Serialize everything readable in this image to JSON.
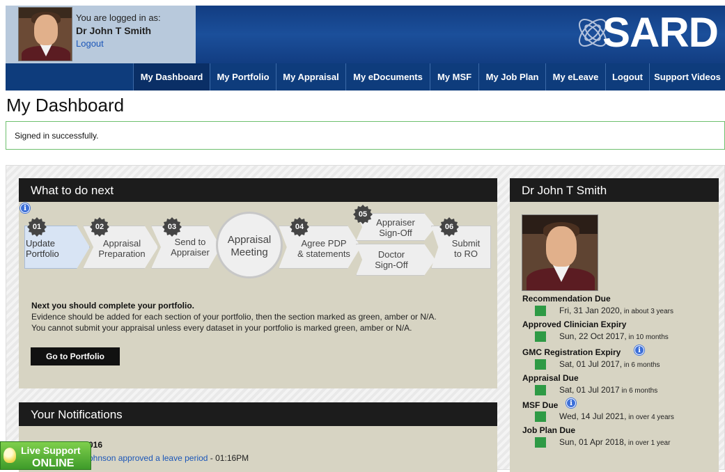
{
  "header": {
    "logged_label": "You are logged in as:",
    "user_name": "Dr John T Smith",
    "logout": "Logout",
    "logo": "SARD"
  },
  "nav": [
    {
      "label": "My Dashboard"
    },
    {
      "label": "My Portfolio"
    },
    {
      "label": "My Appraisal"
    },
    {
      "label": "My eDocuments"
    },
    {
      "label": "My MSF"
    },
    {
      "label": "My Job Plan"
    },
    {
      "label": "My eLeave"
    },
    {
      "label": "Logout"
    },
    {
      "label": "Support Videos"
    }
  ],
  "page_title": "My Dashboard",
  "flash": "Signed in successfully.",
  "what_to_do": {
    "title": "What to do next",
    "steps": [
      {
        "num": "01",
        "label_line1": "Update",
        "label_line2": "Portfolio"
      },
      {
        "num": "02",
        "label_line1": "Appraisal",
        "label_line2": "Preparation"
      },
      {
        "num": "03",
        "label_line1": "Send to",
        "label_line2": "Appraiser"
      },
      {
        "num": "",
        "label_line1": "Appraisal",
        "label_line2": "Meeting"
      },
      {
        "num": "04",
        "label_line1": "Agree PDP",
        "label_line2": "& statements"
      },
      {
        "num": "05",
        "label_line1": "Appraiser",
        "label_line2": "Sign-Off",
        "label_line3": "Doctor",
        "label_line4": "Sign-Off"
      },
      {
        "num": "06",
        "label_line1": "Submit",
        "label_line2": "to RO"
      }
    ],
    "next_title": "Next you should complete your portfolio.",
    "next_line1": "Evidence should be added for each section of your portfolio, then the section marked as green, amber or N/A.",
    "next_line2": "You cannot submit your appraisal unless every dataset in your portfolio is marked green, amber or N/A.",
    "button": "Go to Portfolio"
  },
  "notifications": {
    "title": "Your Notifications",
    "date": "016",
    "link_text": "ohnson approved a leave period",
    "time": " - 01:16PM"
  },
  "profile": {
    "name": "Dr John T Smith",
    "dates": [
      {
        "title": "Recommendation Due",
        "date": "Fri, 31 Jan 2020,",
        "rel": " in about 3 years",
        "info": false
      },
      {
        "title": "Approved Clinician Expiry",
        "date": "Sun, 22 Oct 2017,",
        "rel": " in 10 months",
        "info": false
      },
      {
        "title": "GMC Registration Expiry",
        "date": "Sat, 01 Jul 2017,",
        "rel": " in 6 months",
        "info": true
      },
      {
        "title": "Appraisal Due",
        "date": "Sat, 01 Jul 2017",
        "rel": " in 6 months",
        "info": false
      },
      {
        "title": "MSF Due",
        "date": "Wed, 14 Jul 2021,",
        "rel": " in over 4 years",
        "info": true
      },
      {
        "title": "Job Plan Due",
        "date": "Sun, 01 Apr 2018,",
        "rel": " in over 1 year",
        "info": false
      }
    ],
    "status_color": "#2e9a45"
  },
  "live_support": {
    "top": "Live Support",
    "bottom": "ONLINE"
  },
  "colors": {
    "nav_bg": "#0e3c7c",
    "panel_bg": "#d7d4c3",
    "panel_head": "#1c1c1c"
  }
}
